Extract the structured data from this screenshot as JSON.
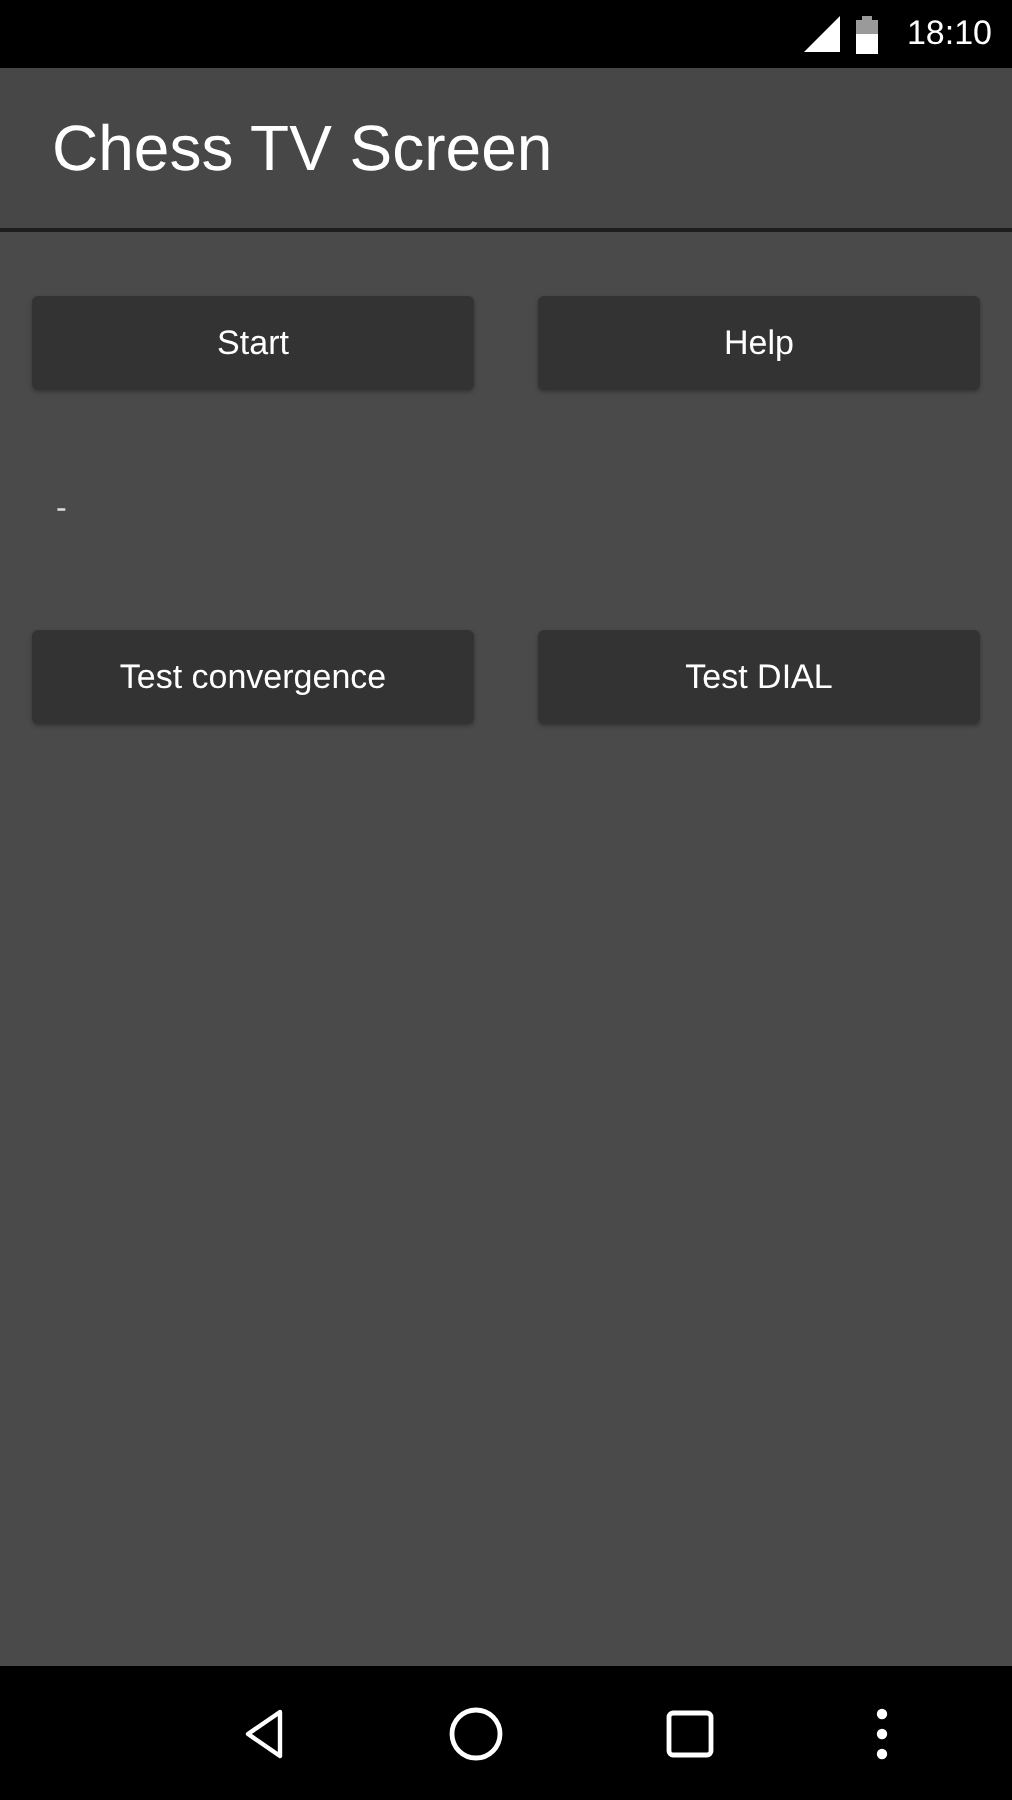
{
  "status_bar": {
    "time": "18:10"
  },
  "app_bar": {
    "title": "Chess TV Screen"
  },
  "button_rows": [
    [
      "Start",
      "Help"
    ],
    [
      "Test convergence",
      "Test DIAL"
    ]
  ],
  "status_text": "-"
}
